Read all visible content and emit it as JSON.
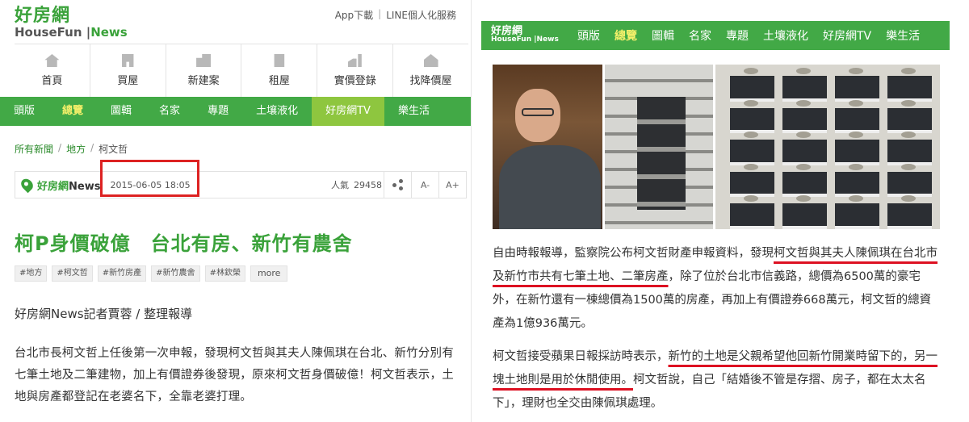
{
  "left": {
    "logo": {
      "cn": "好房網",
      "en_main": "HouseFun",
      "en_sub": "News"
    },
    "top_links": [
      "App下載",
      "LINE個人化服務"
    ],
    "main_nav": [
      {
        "label": "首頁",
        "icon": "home-icon"
      },
      {
        "label": "買屋",
        "icon": "house-icon"
      },
      {
        "label": "新建案",
        "icon": "building-icon"
      },
      {
        "label": "租屋",
        "icon": "rent-icon"
      },
      {
        "label": "實價登錄",
        "icon": "chart-icon"
      },
      {
        "label": "找降價屋",
        "icon": "discount-house-icon"
      }
    ],
    "sub_nav": [
      "頭版",
      "總覽",
      "圖輯",
      "名家",
      "專題",
      "土壤液化",
      "好房網TV",
      "樂生活"
    ],
    "breadcrumb": [
      "所有新聞",
      "地方",
      "柯文哲"
    ],
    "source": {
      "name": "好房網",
      "suffix": "News"
    },
    "date": "2015-06-05 18:05",
    "views_label": "人氣",
    "views": "29458",
    "font_small": "A-",
    "font_large": "A+",
    "title": "柯P身價破億　台北有房、新竹有農舍",
    "tags": [
      "#地方",
      "#柯文哲",
      "#新竹房產",
      "#新竹農舍",
      "#林欽榮",
      "more"
    ],
    "reporter": "好房網News記者賈蓉 / 整理報導",
    "paragraph": "台北市長柯文哲上任後第一次申報，發現柯文哲與其夫人陳佩琪在台北、新竹分別有七筆土地及二筆建物，加上有價證券後發現，原來柯文哲身價破億！柯文哲表示，土地與房產都登記在老婆名下，全靠老婆打理。"
  },
  "right": {
    "logo": {
      "cn": "好房網",
      "en": "HouseFun",
      "sub": "News"
    },
    "nav": [
      "頭版",
      "總覽",
      "圖輯",
      "名家",
      "專題",
      "土壤液化",
      "好房網TV",
      "樂生活"
    ],
    "p1": {
      "a": "自由時報報導，監察院公布柯文哲財產申報資料，發現",
      "b": "柯文哲與其夫人陳佩琪在台北市及新竹市共有七筆土地、二筆房產",
      "c": "，除了位於台北市信義路，總價為6500萬的豪宅外，在新竹還有一棟總價為1500萬的房產，再加上有價證券668萬元，柯文哲的總資產為1億936萬元。"
    },
    "p2": {
      "a": "柯文哲接受蘋果日報採訪時表示，",
      "b": "新竹的土地是父親希望他回新竹開業時留下的，另一塊土地則是用於休閒使用。",
      "c": "柯文哲說，自己「結婚後不管是存摺、房子，都在太太名下」，理財也全交由陳佩琪處理。"
    }
  }
}
